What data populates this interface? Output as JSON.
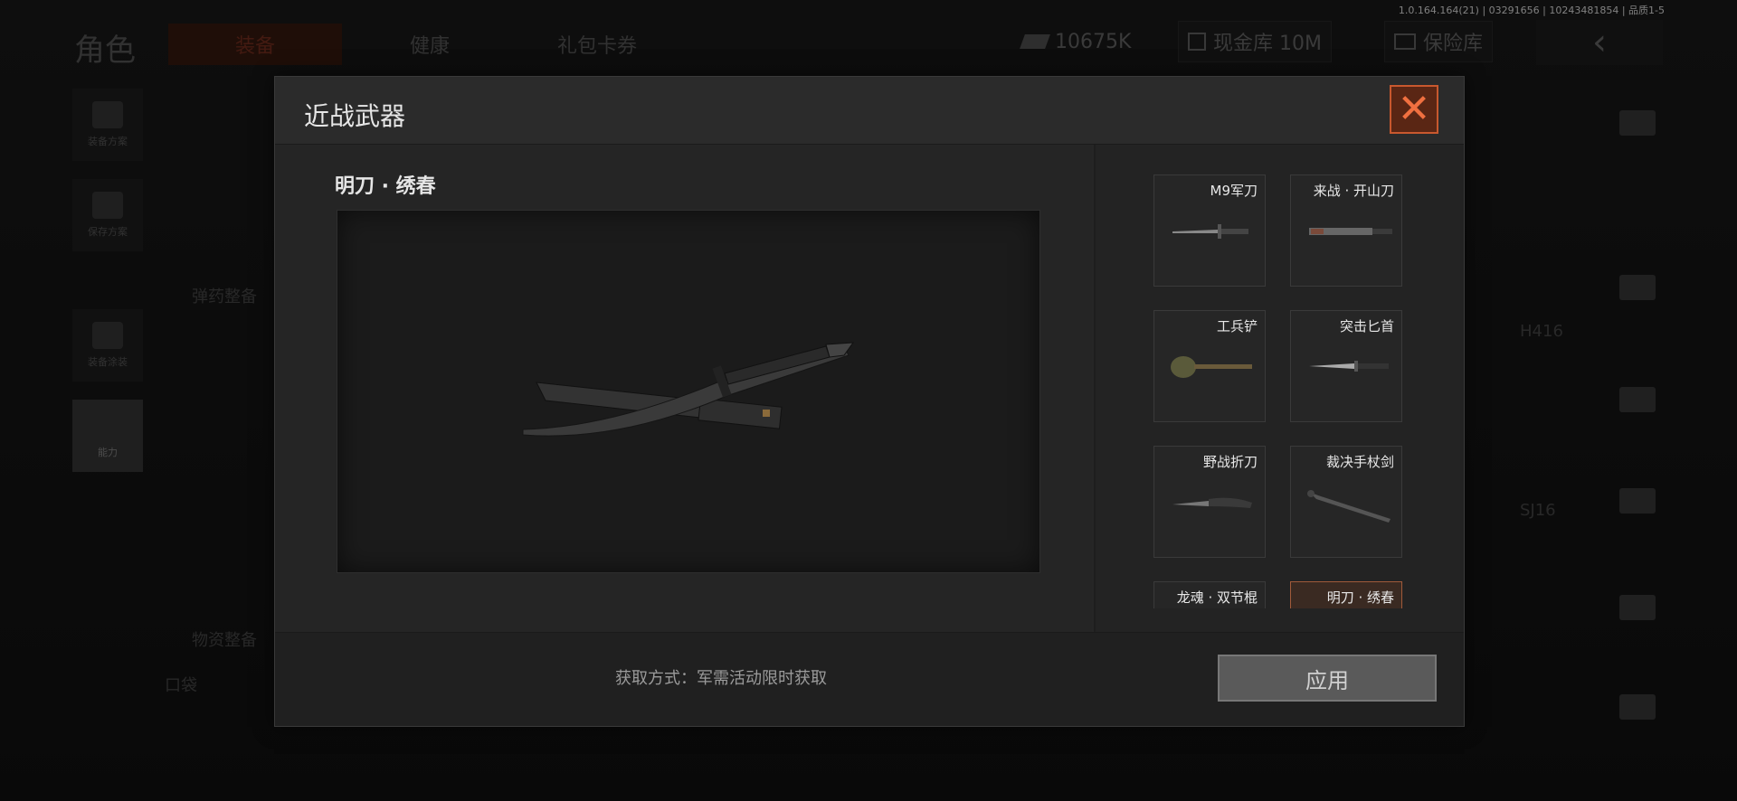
{
  "version": "1.0.164.164(21) | 03291656 | 10243481854 | 品质1-5",
  "background": {
    "title": "角色",
    "tabs": [
      "装备",
      "健康",
      "礼包卡券"
    ],
    "resources": [
      {
        "icon": "cash-icon",
        "value": "10675K"
      },
      {
        "icon": "vault-icon",
        "value": "现金库 10M"
      },
      {
        "icon": "safe-icon",
        "value": "保险库"
      }
    ],
    "sidebar": [
      "装备方案",
      "保存方案",
      "装备涂装",
      "能力"
    ],
    "texts": [
      "弹药整备",
      "物资整备",
      "口袋",
      "H416",
      "SJ16"
    ]
  },
  "modal": {
    "title": "近战武器",
    "close_label": "✕",
    "selected_weapon": "明刀 · 绣春",
    "items": [
      {
        "label": "M9军刀",
        "icon": "bayonet-icon"
      },
      {
        "label": "来战 · 开山刀",
        "icon": "machete-icon"
      },
      {
        "label": "工兵铲",
        "icon": "shovel-icon"
      },
      {
        "label": "突击匕首",
        "icon": "dagger-icon"
      },
      {
        "label": "野战折刀",
        "icon": "folding-knife-icon"
      },
      {
        "label": "裁决手杖剑",
        "icon": "cane-sword-icon"
      },
      {
        "label": "龙魂 · 双节棍",
        "icon": "nunchaku-icon"
      },
      {
        "label": "明刀 · 绣春",
        "icon": "katana-icon",
        "selected": true
      }
    ],
    "acquire_text": "获取方式：军需活动限时获取",
    "apply_label": "应用"
  },
  "colors": {
    "accent": "#c8582e",
    "selected_bg": "#3a2a22"
  }
}
